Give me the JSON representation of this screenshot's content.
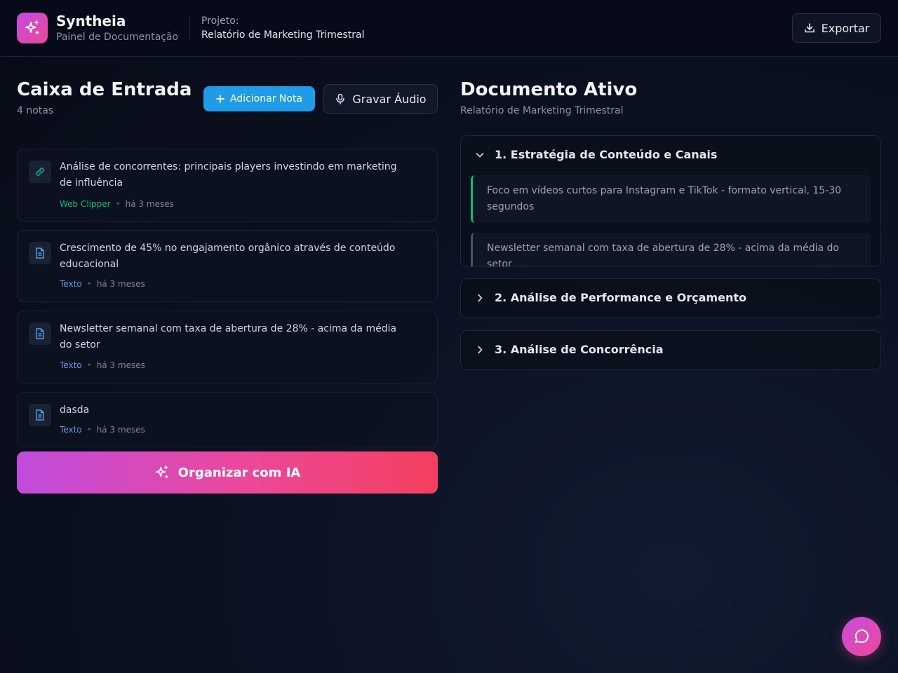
{
  "header": {
    "brand_name": "Syntheia",
    "brand_subtitle": "Painel de Documentação",
    "project_label": "Projeto:",
    "project_name": "Relatório de Marketing Trimestral",
    "export_label": "Exportar"
  },
  "inbox": {
    "title": "Caixa de Entrada",
    "count_label": "4 notas",
    "add_note_label": "Adicionar Nota",
    "record_audio_label": "Gravar Áudio",
    "notes": [
      {
        "icon": "link-icon",
        "text": "Análise de concorrentes: principais players investindo em marketing de influência",
        "source": "Web Clipper",
        "time": "há 3 meses",
        "source_color": "#10b981"
      },
      {
        "icon": "document-icon",
        "text": "Crescimento de 45% no engajamento orgânico através de conteúdo educacional",
        "source": "Texto",
        "time": "há 3 meses",
        "source_color": "#5b9be6"
      },
      {
        "icon": "document-icon",
        "text": "Newsletter semanal com taxa de abertura de 28% - acima da média do setor",
        "source": "Texto",
        "time": "há 3 meses",
        "source_color": "#5b9be6"
      },
      {
        "icon": "document-icon",
        "text": "dasda",
        "source": "Texto",
        "time": "há 3 meses",
        "source_color": "#5b9be6"
      }
    ],
    "organize_label": "Organizar com IA"
  },
  "document": {
    "title": "Documento Ativo",
    "subtitle": "Relatório de Marketing Trimestral",
    "sections": [
      {
        "title": "1. Estratégia de Conteúdo e Canais",
        "expanded": true,
        "items": [
          "Foco em vídeos curtos para Instagram e TikTok - formato vertical, 15-30 segundos",
          "Newsletter semanal com taxa de abertura de 28% - acima da média do setor"
        ]
      },
      {
        "title": "2. Análise de Performance e Orçamento",
        "expanded": false,
        "items": []
      },
      {
        "title": "3. Análise de Concorrência",
        "expanded": false,
        "items": []
      }
    ]
  },
  "colors": {
    "accent_blue": "#1f9be8",
    "accent_pink": "#ec4899",
    "accent_green": "#10b981"
  }
}
